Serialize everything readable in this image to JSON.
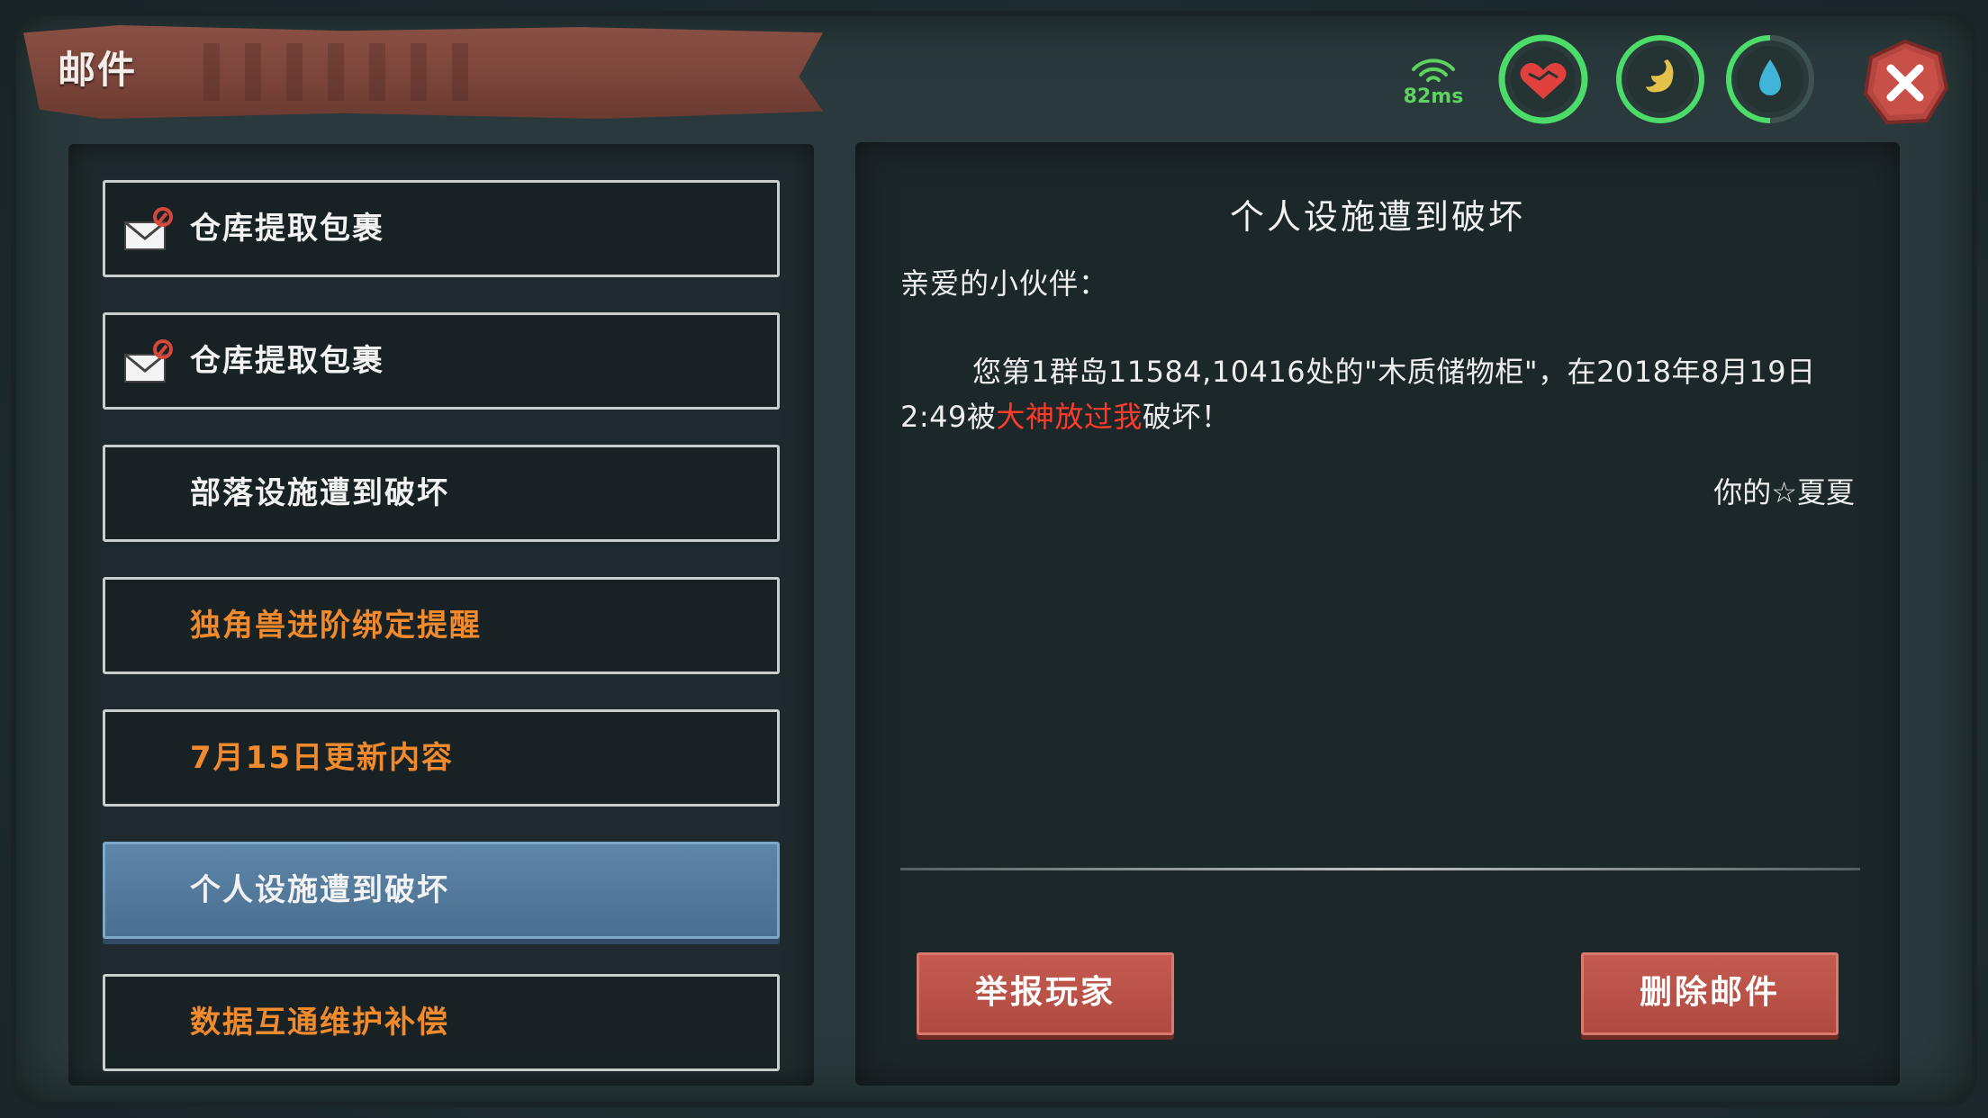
{
  "window": {
    "title": "邮件"
  },
  "status": {
    "ping_label": "82ms",
    "ping_color": "#5fd35f"
  },
  "mail_list": [
    {
      "label": "仓库提取包裹",
      "has_envelope": true,
      "color": "white",
      "selected": false
    },
    {
      "label": "仓库提取包裹",
      "has_envelope": true,
      "color": "white",
      "selected": false
    },
    {
      "label": "部落设施遭到破坏",
      "has_envelope": false,
      "color": "white",
      "selected": false
    },
    {
      "label": "独角兽进阶绑定提醒",
      "has_envelope": false,
      "color": "orange",
      "selected": false
    },
    {
      "label": "7月15日更新内容",
      "has_envelope": false,
      "color": "orange",
      "selected": false
    },
    {
      "label": "个人设施遭到破坏",
      "has_envelope": false,
      "color": "white",
      "selected": true
    },
    {
      "label": "数据互通维护补偿",
      "has_envelope": false,
      "color": "orange",
      "selected": false
    }
  ],
  "mail": {
    "title": "个人设施遭到破坏",
    "greeting": "亲爱的小伙伴：",
    "body_before": "您第1群岛11584,10416处的\"木质储物柜\"，在2018年8月19日 2:49被",
    "body_highlight": "大神放过我",
    "body_after": "破坏！",
    "signature": "你的☆夏夏"
  },
  "buttons": {
    "report": "举报玩家",
    "delete": "删除邮件"
  },
  "colors": {
    "accent_orange": "#f08a2c",
    "highlight_red": "#ff3b2a",
    "selected_blue": "#4a6f90",
    "button_red": "#b04a40"
  }
}
